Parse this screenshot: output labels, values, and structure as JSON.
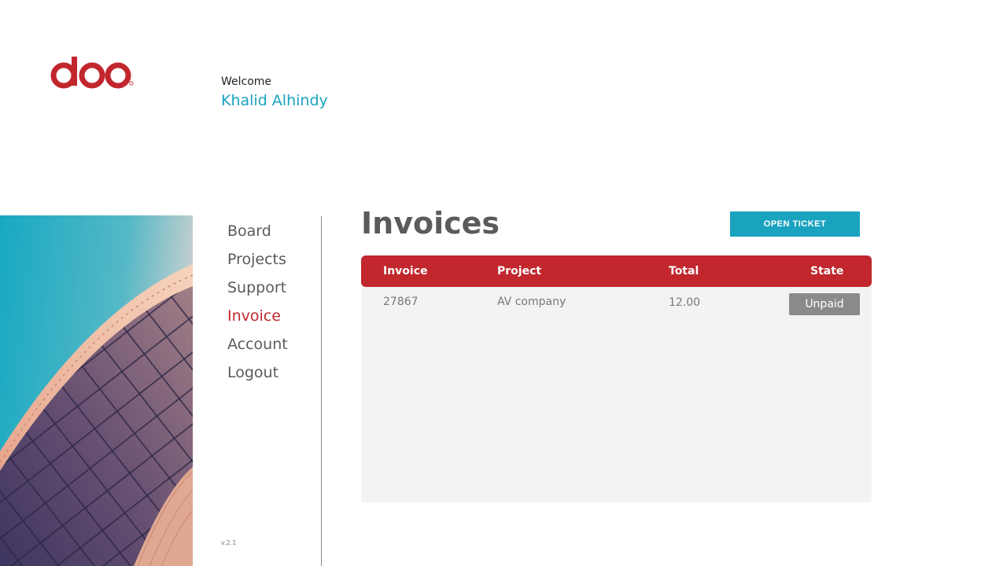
{
  "brand": {
    "logo_name": "doo",
    "accent": "#c1272d",
    "teal": "#1aa3bf"
  },
  "header": {
    "welcome": "Welcome",
    "user_name": "Khalid Alhindy"
  },
  "nav": {
    "items": [
      "Board",
      "Projects",
      "Support",
      "Invoice",
      "Account",
      "Logout"
    ],
    "active": "Invoice"
  },
  "footer": {
    "version": "v.2.1"
  },
  "page": {
    "title": "Invoices",
    "open_ticket_label": "OPEN TICKET"
  },
  "table": {
    "columns": [
      "Invoice",
      "Project",
      "Total",
      "State"
    ],
    "rows": [
      {
        "invoice": "27867",
        "project": "AV company",
        "total": "12.00",
        "state": "Unpaid"
      }
    ]
  }
}
